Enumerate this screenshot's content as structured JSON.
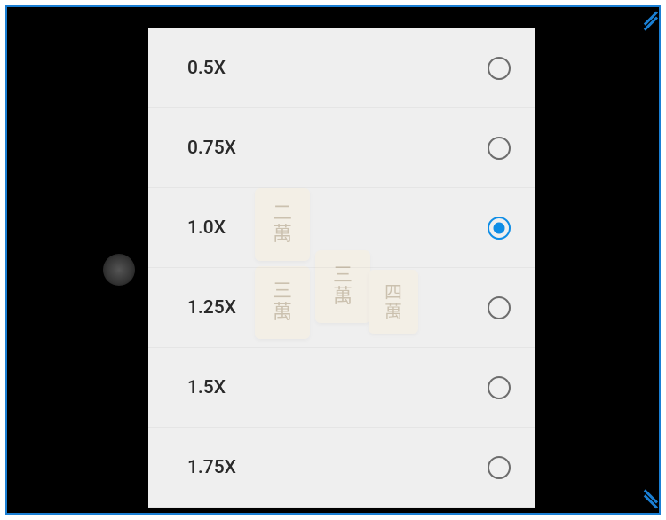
{
  "dialog": {
    "options": [
      {
        "label": "0.5X",
        "selected": false
      },
      {
        "label": "0.75X",
        "selected": false
      },
      {
        "label": "1.0X",
        "selected": true
      },
      {
        "label": "1.25X",
        "selected": false
      },
      {
        "label": "1.5X",
        "selected": false
      },
      {
        "label": "1.75X",
        "selected": false
      }
    ]
  },
  "background_tiles": {
    "tile1": {
      "top": "二",
      "bottom": "萬"
    },
    "tile2": {
      "top": "三",
      "bottom": "萬"
    },
    "tile3": {
      "top": "三",
      "bottom": "萬"
    },
    "tile4": {
      "top": "四",
      "bottom": "萬"
    }
  },
  "colors": {
    "frame_border": "#1a7fd4",
    "accent": "#0e8de6",
    "dialog_bg": "#efefef"
  }
}
